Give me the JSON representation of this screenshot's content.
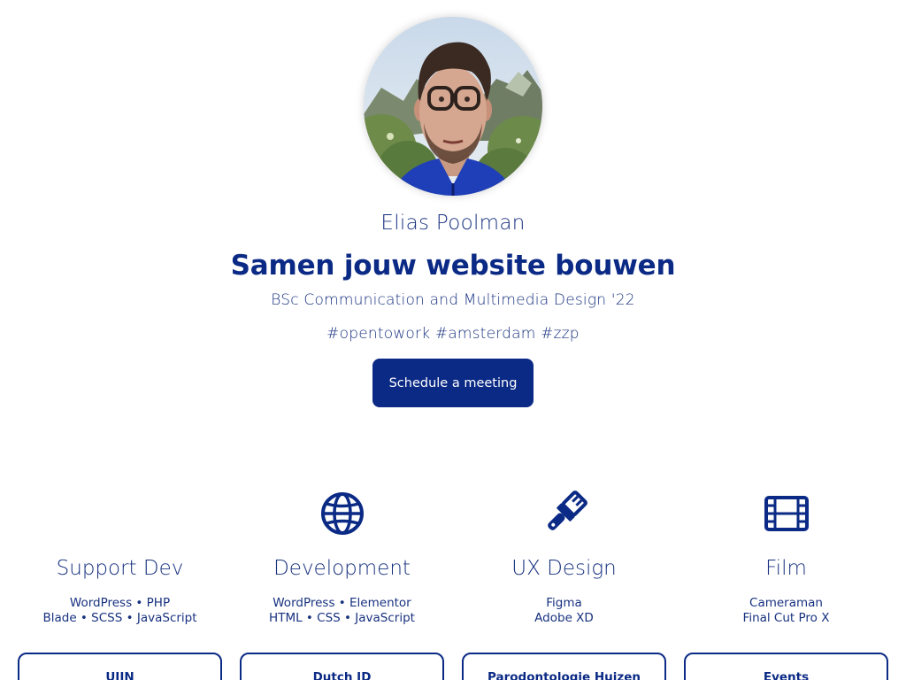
{
  "profile": {
    "name": "Elias Poolman",
    "headline": "Samen jouw website bouwen",
    "degree": "BSc Communication and Multimedia Design '22",
    "tags": "#opentowork #amsterdam #zzp",
    "cta_label": "Schedule a meeting"
  },
  "colors": {
    "primary": "#0b2a85",
    "text": "#17317f",
    "background": "#ffffff"
  },
  "services": [
    {
      "icon": "code-icon",
      "title": "Support Dev",
      "line1": "WordPress • PHP",
      "line2": "Blade • SCSS • JavaScript",
      "card": "UIIN"
    },
    {
      "icon": "globe-icon",
      "title": "Development",
      "line1": "WordPress • Elementor",
      "line2": "HTML • CSS • JavaScript",
      "card": "Dutch ID"
    },
    {
      "icon": "paintbrush-icon",
      "title": "UX Design",
      "line1": "Figma",
      "line2": "Adobe XD",
      "card": "Parodontologie Huizen"
    },
    {
      "icon": "film-icon",
      "title": "Film",
      "line1": "Cameraman",
      "line2": "Final Cut Pro X",
      "card": "Events"
    }
  ]
}
